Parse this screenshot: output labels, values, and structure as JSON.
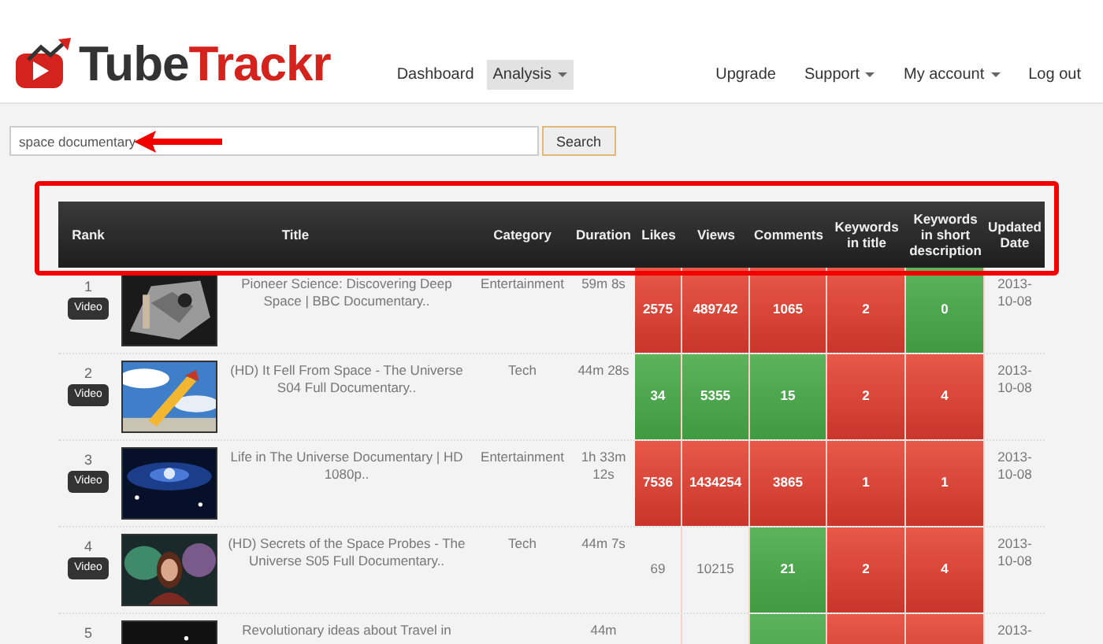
{
  "brand": {
    "part_1": "Tube",
    "part_2": "Trackr"
  },
  "nav_left": [
    {
      "label": "Dashboard",
      "selected": false,
      "dropdown": false
    },
    {
      "label": "Analysis",
      "selected": true,
      "dropdown": true
    }
  ],
  "nav_right": [
    {
      "label": "Upgrade",
      "dropdown": false
    },
    {
      "label": "Support",
      "dropdown": true
    },
    {
      "label": "My account",
      "dropdown": true
    },
    {
      "label": "Log out",
      "dropdown": false
    }
  ],
  "search": {
    "value": "space documentary",
    "button": "Search"
  },
  "table": {
    "columns": [
      "Rank",
      "Title",
      "Category",
      "Duration",
      "Likes",
      "Views",
      "Comments",
      "Keywords in title",
      "Keywords in short description",
      "Updated Date"
    ],
    "rows": [
      {
        "rank": "1",
        "badge": "Video",
        "title": "Pioneer Science: Discovering Deep Space | BBC Documentary..",
        "category": "Entertainment",
        "duration": "59m 8s",
        "metrics": [
          {
            "text": "2575",
            "kind": "bad"
          },
          {
            "text": "489742",
            "kind": "bad"
          },
          {
            "text": "1065",
            "kind": "bad"
          },
          {
            "text": "2",
            "kind": "bad"
          },
          {
            "text": "0",
            "kind": "good"
          }
        ],
        "date": "2013-10-08"
      },
      {
        "rank": "2",
        "badge": "Video",
        "title": "(HD) It Fell From Space - The Universe S04 Full Documentary..",
        "category": "Tech",
        "duration": "44m 28s",
        "metrics": [
          {
            "text": "34",
            "kind": "good"
          },
          {
            "text": "5355",
            "kind": "good"
          },
          {
            "text": "15",
            "kind": "good"
          },
          {
            "text": "2",
            "kind": "bad"
          },
          {
            "text": "4",
            "kind": "bad"
          }
        ],
        "date": "2013-10-08"
      },
      {
        "rank": "3",
        "badge": "Video",
        "title": "Life in The Universe Documentary | HD 1080p..",
        "category": "Entertainment",
        "duration": "1h 33m 12s",
        "metrics": [
          {
            "text": "7536",
            "kind": "bad"
          },
          {
            "text": "1434254",
            "kind": "bad"
          },
          {
            "text": "3865",
            "kind": "bad"
          },
          {
            "text": "1",
            "kind": "bad"
          },
          {
            "text": "1",
            "kind": "bad"
          }
        ],
        "date": "2013-10-08"
      },
      {
        "rank": "4",
        "badge": "Video",
        "title": "(HD) Secrets of the Space Probes - The Universe S05 Full Documentary..",
        "category": "Tech",
        "duration": "44m 7s",
        "metrics": [
          {
            "text": "69",
            "kind": "plain"
          },
          {
            "text": "10215",
            "kind": "plain"
          },
          {
            "text": "21",
            "kind": "good"
          },
          {
            "text": "2",
            "kind": "bad"
          },
          {
            "text": "4",
            "kind": "bad"
          }
        ],
        "date": "2013-10-08"
      },
      {
        "rank": "5",
        "title": "Revolutionary ideas about Travel in",
        "duration": "44m",
        "metrics": [
          {
            "kind": "plain"
          },
          {
            "kind": "plain"
          },
          {
            "kind": "good"
          },
          {
            "kind": "bad"
          },
          {
            "kind": "bad"
          }
        ],
        "date": "2013-"
      }
    ]
  }
}
